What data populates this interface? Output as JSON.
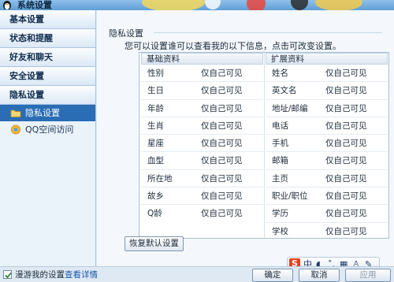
{
  "window": {
    "title": "系统设置"
  },
  "sidebar": {
    "categories": [
      {
        "label": "基本设置"
      },
      {
        "label": "状态和提醒"
      },
      {
        "label": "好友和聊天"
      },
      {
        "label": "安全设置"
      },
      {
        "label": "隐私设置"
      }
    ],
    "subitems": [
      {
        "label": "隐私设置",
        "icon": "folder-icon",
        "active": true
      },
      {
        "label": "QQ空间访问",
        "icon": "qzone-icon",
        "active": false
      }
    ]
  },
  "main": {
    "section_title": "隐私设置",
    "description": "您可以设置谁可以查看我的以下信息，点击可改变设置。",
    "basic": {
      "header": "基础资料",
      "rows": [
        {
          "field": "性别",
          "value": "仅自己可见"
        },
        {
          "field": "生日",
          "value": "仅自己可见"
        },
        {
          "field": "年龄",
          "value": "仅自己可见"
        },
        {
          "field": "生肖",
          "value": "仅自己可见"
        },
        {
          "field": "星座",
          "value": "仅自己可见"
        },
        {
          "field": "血型",
          "value": "仅自己可见"
        },
        {
          "field": "所在地",
          "value": "仅自己可见"
        },
        {
          "field": "故乡",
          "value": "仅自己可见"
        },
        {
          "field": "Q龄",
          "value": "仅自己可见"
        }
      ]
    },
    "extended": {
      "header": "扩展资料",
      "rows": [
        {
          "field": "姓名",
          "value": "仅自己可见"
        },
        {
          "field": "英文名",
          "value": "仅自己可见"
        },
        {
          "field": "地址/邮编",
          "value": "仅自己可见"
        },
        {
          "field": "电话",
          "value": "仅自己可见"
        },
        {
          "field": "手机",
          "value": "仅自己可见"
        },
        {
          "field": "邮箱",
          "value": "仅自己可见"
        },
        {
          "field": "主页",
          "value": "仅自己可见"
        },
        {
          "field": "职业/职位",
          "value": "仅自己可见"
        },
        {
          "field": "学历",
          "value": "仅自己可见"
        },
        {
          "field": "学校",
          "value": "仅自己可见"
        }
      ]
    },
    "restore_button": "恢复默认设置"
  },
  "footer": {
    "roaming_label": "漫游我的设置",
    "roaming_checked": true,
    "details_link": "查看详情",
    "ok": "确定",
    "cancel": "取消",
    "apply": "应用"
  },
  "ime": {
    "logo": "S",
    "mode": "中"
  },
  "colors": {
    "accent": "#2a6db5",
    "link": "#1a56a8",
    "ime_logo": "#e8401c"
  }
}
